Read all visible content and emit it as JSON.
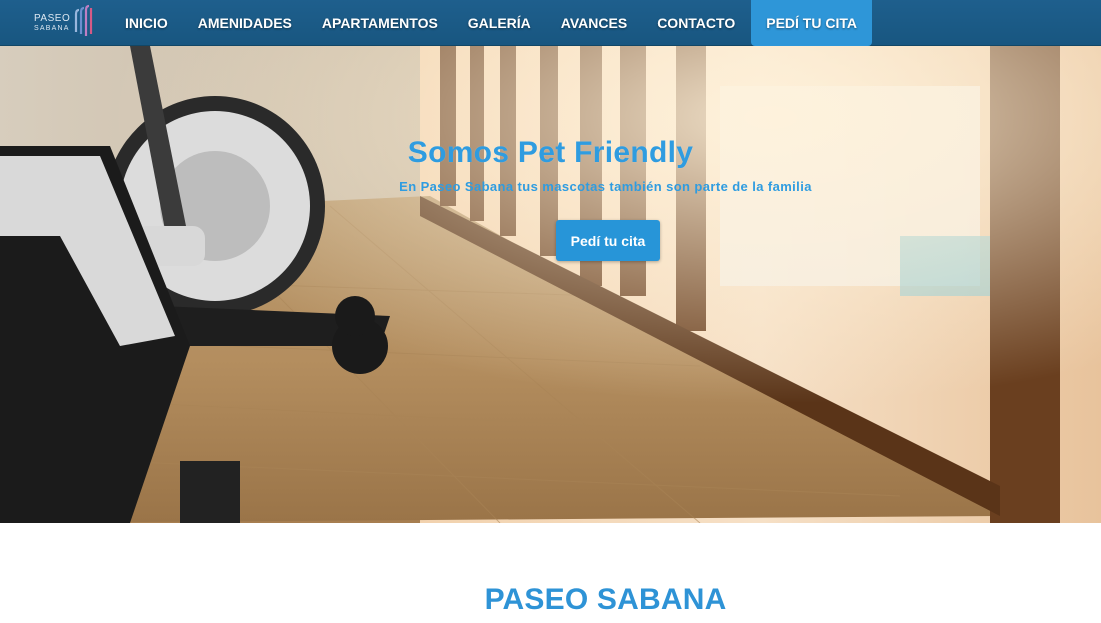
{
  "brand": {
    "logo_line1": "PASEO",
    "logo_line2": "SABANA",
    "logo_colors": [
      "#9ab7dd",
      "#6d8fcf",
      "#c07fc4",
      "#d45a86"
    ]
  },
  "nav": {
    "items": [
      {
        "label": "INICIO"
      },
      {
        "label": "AMENIDADES"
      },
      {
        "label": "APARTAMENTOS"
      },
      {
        "label": "GALERÍA"
      },
      {
        "label": "AVANCES"
      },
      {
        "label": "CONTACTO"
      },
      {
        "label": "PEDÍ TU CITA"
      }
    ],
    "bar_color": "#1b5a85",
    "cta_color": "#2e96d8"
  },
  "hero": {
    "title": "Somos Pet Friendly",
    "subtitle": "En Paseo Sabana tus mascotas también son parte de la familia",
    "button_label": "Pedí tu cita",
    "accent_color": "#2f9ce0"
  },
  "section": {
    "title": "PASEO SABANA"
  }
}
